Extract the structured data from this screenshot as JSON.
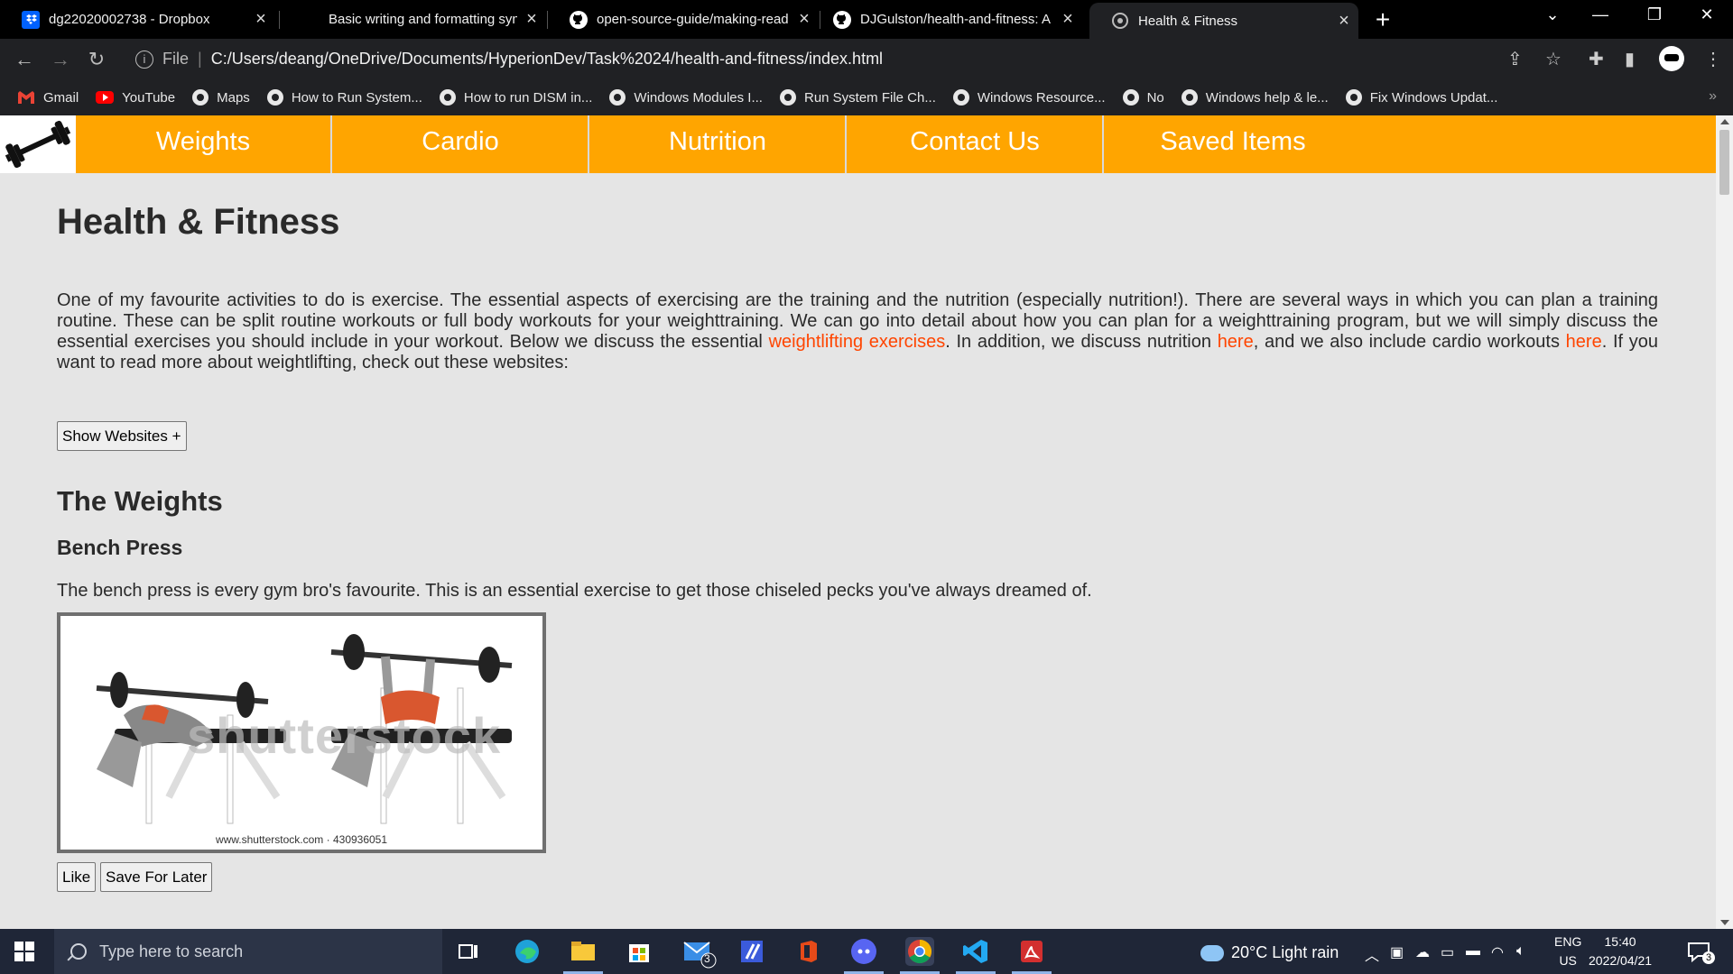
{
  "tabs": [
    {
      "title": "dg22020002738 - Dropbox",
      "icon": "dropbox-icon",
      "active": false
    },
    {
      "title": "Basic writing and formatting synt",
      "icon": "none",
      "active": false
    },
    {
      "title": "open-source-guide/making-read",
      "icon": "github-icon",
      "active": false
    },
    {
      "title": "DJGulston/health-and-fitness: A",
      "icon": "github-icon",
      "active": false
    },
    {
      "title": "Health & Fitness",
      "icon": "globe-icon",
      "active": true
    }
  ],
  "address": {
    "scheme_label": "File",
    "url": "C:/Users/deang/OneDrive/Documents/HyperionDev/Task%2024/health-and-fitness/index.html"
  },
  "bookmarks": [
    "Gmail",
    "YouTube",
    "Maps",
    "How to Run System...",
    "How to run DISM in...",
    "Windows Modules I...",
    "Run System File Ch...",
    "Windows Resource...",
    "No",
    "Windows help & le...",
    "Fix Windows Updat..."
  ],
  "site": {
    "nav": [
      "Weights",
      "Cardio",
      "Nutrition",
      "Contact Us",
      "Saved Items"
    ],
    "title": "Health & Fitness",
    "intro_1": "One of my favourite activities to do is exercise. The essential aspects of exercising are the training and the nutrition (especially nutrition!). There are several ways in which you can plan a training routine. These can be split routine workouts or full body workouts for your weighttraining. We can go into detail about how you can plan for a weighttraining program, but we will simply discuss the essential exercises you should include in your workout. Below we discuss the essential ",
    "link_weightlifting": "weightlifting exercises",
    "intro_2": ". In addition, we discuss nutrition ",
    "link_nutrition": "here",
    "intro_3": ", and we also include cardio workouts ",
    "link_cardio": "here",
    "intro_4": ". If you want to read more about weightlifting, check out these websites:",
    "show_websites": "Show Websites +",
    "weights_heading": "The Weights",
    "bench_heading": "Bench Press",
    "bench_text": "The bench press is every gym bro's favourite. This is an essential exercise to get those chiseled pecks you've always dreamed of.",
    "image_watermark": "shutterstock",
    "image_credit": "www.shutterstock.com · 430936051",
    "like": "Like",
    "save_later": "Save For Later"
  },
  "taskbar": {
    "search_placeholder": "Type here to search",
    "weather": "20°C  Light rain",
    "lang_1": "ENG",
    "lang_2": "US",
    "time": "15:40",
    "date": "2022/04/21",
    "mail_badge": "3",
    "notif_badge": "3"
  },
  "colors": {
    "nav_bg": "#ffa500",
    "link": "#ff4500",
    "page_bg": "#e5e5e5"
  }
}
